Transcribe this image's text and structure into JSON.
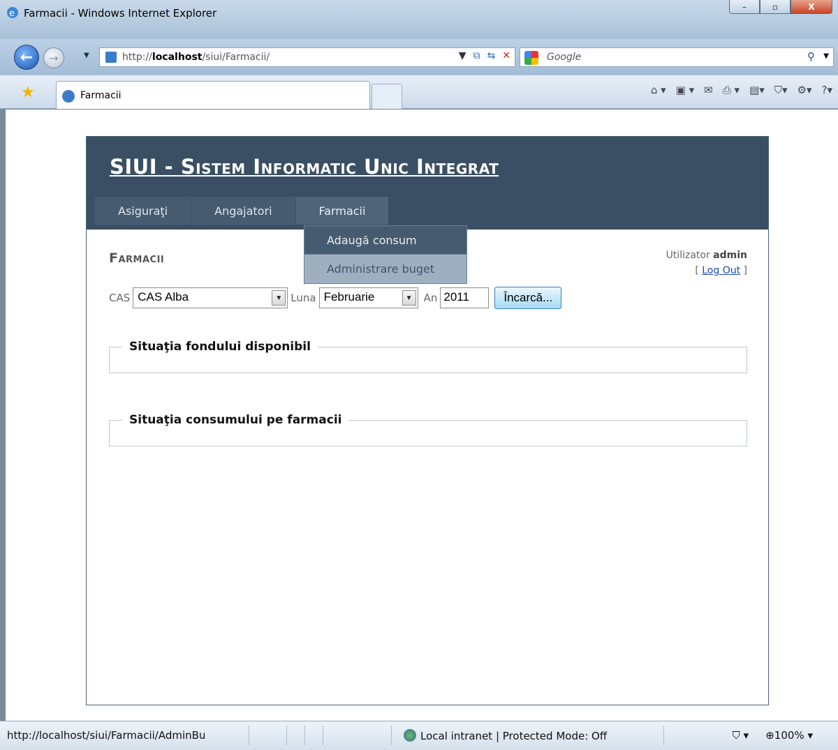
{
  "window": {
    "title": "Farmacii - Windows Internet Explorer",
    "min": "–",
    "max": "▫",
    "close": "X"
  },
  "browser": {
    "url_prefix": "http://",
    "url_host": "localhost",
    "url_path": "/siui/Farmacii/",
    "search_placeholder": "Google",
    "tab_title": "Farmacii",
    "toolbar_icons": [
      "home-icon",
      "feeds-icon",
      "read-mail-icon",
      "print-icon",
      "page-icon",
      "safety-icon",
      "tools-icon",
      "help-icon"
    ]
  },
  "site": {
    "title": "SIUI - Sistem Informatic Unic Integrat",
    "menu": [
      {
        "label": "Asiguraţi"
      },
      {
        "label": "Angajatori"
      },
      {
        "label": "Farmacii"
      }
    ],
    "submenu": [
      {
        "label": "Adaugă consum"
      },
      {
        "label": "Administrare buget"
      }
    ],
    "page_heading": "Farmacii",
    "login": {
      "user_label": "Utilizator",
      "username": "admin",
      "bracket_open": "[",
      "logout": "Log Out",
      "bracket_close": "]"
    },
    "filter": {
      "cas_label": "CAS",
      "cas_value": "CAS Alba",
      "luna_label": "Luna",
      "luna_value": "Februarie",
      "an_label": "An",
      "an_value": "2011",
      "load_button": "Încarcă..."
    },
    "fieldsets": [
      {
        "legend": "Situaţia fondului disponibil"
      },
      {
        "legend": "Situaţia consumului pe farmacii"
      }
    ]
  },
  "status": {
    "url": "http://localhost/siui/Farmacii/AdminBu",
    "zone": "Local intranet | Protected Mode: Off",
    "zoom": "100%"
  }
}
